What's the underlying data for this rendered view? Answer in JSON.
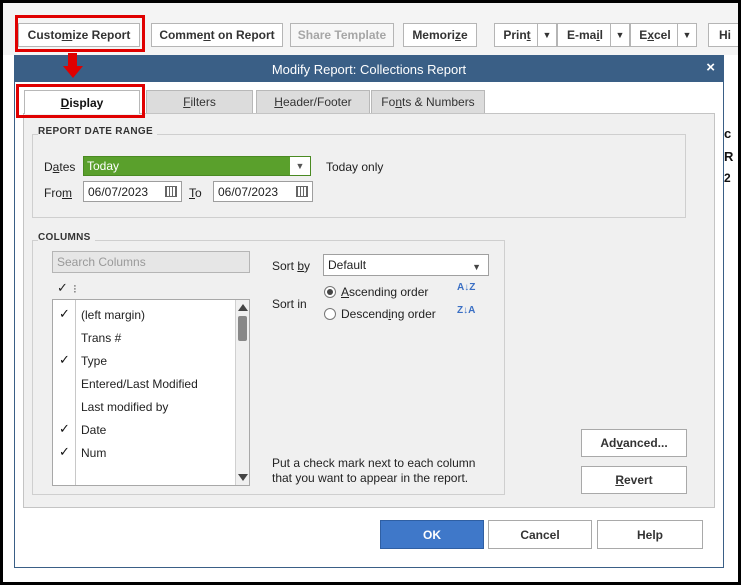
{
  "toolbar": {
    "customize_report": {
      "pre": "Custo",
      "u": "m",
      "post": "ize Report"
    },
    "comment_on_report": {
      "pre": "Comme",
      "u": "n",
      "post": "t on Report"
    },
    "share_template": "Share Template",
    "memorize": {
      "pre": "Memori",
      "u": "z",
      "post": "e"
    },
    "print": {
      "pre": "Prin",
      "u": "t",
      "post": ""
    },
    "email": {
      "pre": "E-ma",
      "u": "i",
      "post": "l"
    },
    "excel": {
      "pre": "E",
      "u": "x",
      "post": "cel"
    },
    "hide": "Hi",
    "arrow_glyph": "▼"
  },
  "report_peek": [
    "c",
    "R",
    "2"
  ],
  "dialog": {
    "title": "Modify Report: Collections Report",
    "close_glyph": "×",
    "tabs": [
      {
        "pre": "",
        "u": "D",
        "post": "isplay"
      },
      {
        "pre": "",
        "u": "F",
        "post": "ilters"
      },
      {
        "pre": "",
        "u": "H",
        "post": "eader/Footer"
      },
      {
        "pre": "Fo",
        "u": "n",
        "post": "ts & Numbers"
      }
    ],
    "date_range": {
      "group_title": "REPORT DATE RANGE",
      "dates_label": {
        "pre": "D",
        "u": "a",
        "post": "tes"
      },
      "dates_value": "Today",
      "dates_hint": "Today only",
      "from_label": {
        "pre": "Fro",
        "u": "m",
        "post": ""
      },
      "from_value": "06/07/2023",
      "to_label": {
        "pre": "",
        "u": "T",
        "post": "o"
      },
      "to_value": "06/07/2023"
    },
    "columns": {
      "group_title": "COLUMNS",
      "search_placeholder": "Search Columns",
      "header_check": "✓",
      "header_glyph": "⁝",
      "items": [
        {
          "check": "✓",
          "label": "(left margin)"
        },
        {
          "check": "",
          "label": "Trans #"
        },
        {
          "check": "✓",
          "label": "Type"
        },
        {
          "check": "",
          "label": "Entered/Last Modified"
        },
        {
          "check": "",
          "label": "Last modified by"
        },
        {
          "check": "✓",
          "label": "Date"
        },
        {
          "check": "✓",
          "label": "Num"
        }
      ],
      "sort_by_label": {
        "pre": "Sort ",
        "u": "b",
        "post": "y"
      },
      "sort_by_value": "Default",
      "sort_in_label": "Sort in",
      "ascending": {
        "pre": "",
        "u": "A",
        "post": "scending order"
      },
      "descending": {
        "pre": "Descend",
        "u": "i",
        "post": "ng order"
      },
      "asc_icon": "A↓Z",
      "desc_icon": "Z↓A",
      "hint_line1": "Put a check mark next to each column",
      "hint_line2": "that you want to appear in the report."
    },
    "advanced": {
      "pre": "Ad",
      "u": "v",
      "post": "anced..."
    },
    "revert": {
      "pre": "",
      "u": "R",
      "post": "evert"
    },
    "ok": "OK",
    "cancel": "Cancel",
    "help": "Help"
  },
  "colors": {
    "accent_blue": "#3f78c9",
    "title_bar": "#3a5f86",
    "dates_green": "#5aa02c",
    "highlight_red": "#e00000"
  }
}
